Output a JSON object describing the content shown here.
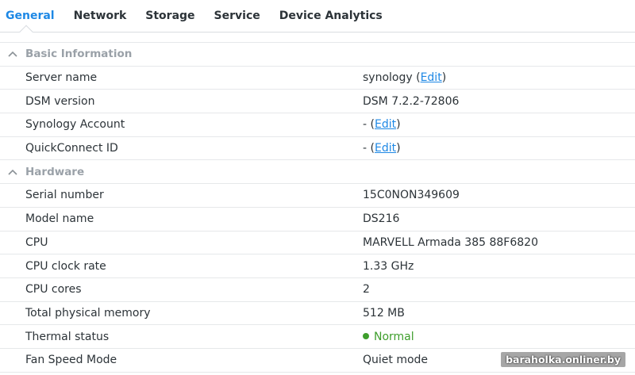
{
  "tabs": [
    {
      "label": "General",
      "active": true
    },
    {
      "label": "Network"
    },
    {
      "label": "Storage"
    },
    {
      "label": "Service"
    },
    {
      "label": "Device Analytics"
    }
  ],
  "basic": {
    "title": "Basic Information",
    "server_name": {
      "label": "Server name",
      "value": "synology",
      "open": " (",
      "link": "Edit",
      "close": ")"
    },
    "dsm_version": {
      "label": "DSM version",
      "value": "DSM 7.2.2-72806"
    },
    "account": {
      "label": "Synology Account",
      "value": "-",
      "open": " (",
      "link": "Edit",
      "close": ")"
    },
    "quickconnect": {
      "label": "QuickConnect ID",
      "value": "-",
      "open": " (",
      "link": "Edit",
      "close": ")"
    }
  },
  "hardware": {
    "title": "Hardware",
    "serial": {
      "label": "Serial number",
      "value": "15C0NON349609"
    },
    "model": {
      "label": "Model name",
      "value": "DS216"
    },
    "cpu": {
      "label": "CPU",
      "value": "MARVELL Armada 385 88F6820"
    },
    "clock": {
      "label": "CPU clock rate",
      "value": "1.33 GHz"
    },
    "cores": {
      "label": "CPU cores",
      "value": "2"
    },
    "memory": {
      "label": "Total physical memory",
      "value": "512 MB"
    },
    "thermal": {
      "label": "Thermal status",
      "value": "Normal",
      "color": "#3e9e2c"
    },
    "fan": {
      "label": "Fan Speed Mode",
      "value": "Quiet mode"
    }
  },
  "watermark": "baraholka.onliner.by",
  "colors": {
    "accent": "#1e88e5",
    "ok": "#3e9e2c"
  }
}
